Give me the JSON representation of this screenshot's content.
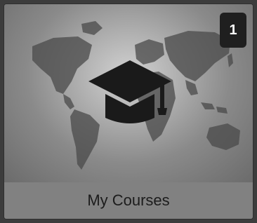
{
  "tile": {
    "title": "My Courses",
    "badge_count": "1",
    "icon": "graduation-cap-icon",
    "background": "world-map",
    "colors": {
      "badge_bg": "#1f1f1f",
      "badge_text": "#ffffff",
      "footer_bg": "#818181",
      "icon": "#1a1a1a"
    }
  }
}
